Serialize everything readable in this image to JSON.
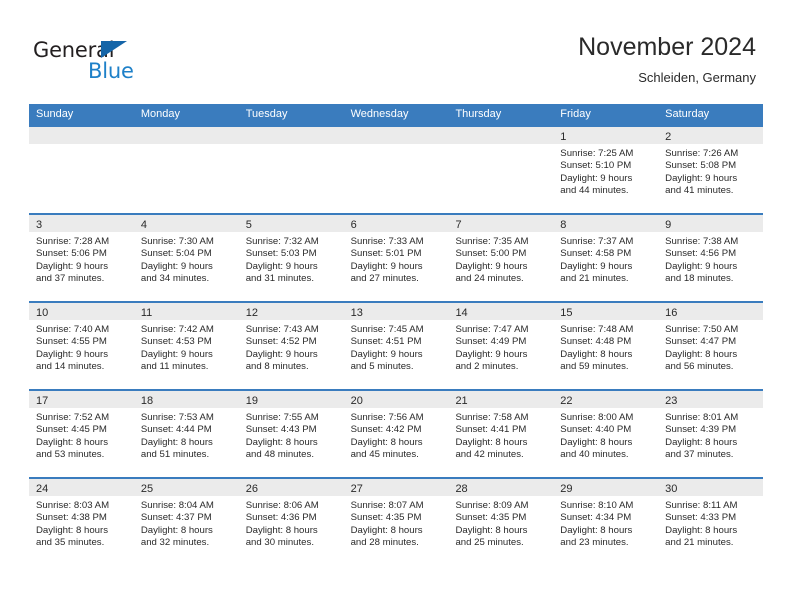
{
  "brand": {
    "name_part1": "General",
    "name_part2": "Blue",
    "triangle_icon": "triangle-icon",
    "accent_color": "#1e80c8",
    "dark_color": "#231f20"
  },
  "header": {
    "title": "November 2024",
    "subtitle": "Schleiden, Germany"
  },
  "theme": {
    "header_blue": "#3a7cbe",
    "daynum_band": "#ebebeb"
  },
  "weekdays": [
    "Sunday",
    "Monday",
    "Tuesday",
    "Wednesday",
    "Thursday",
    "Friday",
    "Saturday"
  ],
  "weeks": [
    [
      {
        "day": "",
        "sunrise": "",
        "sunset": "",
        "daylight_line1": "",
        "daylight_line2": "",
        "empty": true
      },
      {
        "day": "",
        "sunrise": "",
        "sunset": "",
        "daylight_line1": "",
        "daylight_line2": "",
        "empty": true
      },
      {
        "day": "",
        "sunrise": "",
        "sunset": "",
        "daylight_line1": "",
        "daylight_line2": "",
        "empty": true
      },
      {
        "day": "",
        "sunrise": "",
        "sunset": "",
        "daylight_line1": "",
        "daylight_line2": "",
        "empty": true
      },
      {
        "day": "",
        "sunrise": "",
        "sunset": "",
        "daylight_line1": "",
        "daylight_line2": "",
        "empty": true
      },
      {
        "day": "1",
        "sunrise": "Sunrise: 7:25 AM",
        "sunset": "Sunset: 5:10 PM",
        "daylight_line1": "Daylight: 9 hours",
        "daylight_line2": "and 44 minutes.",
        "empty": false
      },
      {
        "day": "2",
        "sunrise": "Sunrise: 7:26 AM",
        "sunset": "Sunset: 5:08 PM",
        "daylight_line1": "Daylight: 9 hours",
        "daylight_line2": "and 41 minutes.",
        "empty": false
      }
    ],
    [
      {
        "day": "3",
        "sunrise": "Sunrise: 7:28 AM",
        "sunset": "Sunset: 5:06 PM",
        "daylight_line1": "Daylight: 9 hours",
        "daylight_line2": "and 37 minutes.",
        "empty": false
      },
      {
        "day": "4",
        "sunrise": "Sunrise: 7:30 AM",
        "sunset": "Sunset: 5:04 PM",
        "daylight_line1": "Daylight: 9 hours",
        "daylight_line2": "and 34 minutes.",
        "empty": false
      },
      {
        "day": "5",
        "sunrise": "Sunrise: 7:32 AM",
        "sunset": "Sunset: 5:03 PM",
        "daylight_line1": "Daylight: 9 hours",
        "daylight_line2": "and 31 minutes.",
        "empty": false
      },
      {
        "day": "6",
        "sunrise": "Sunrise: 7:33 AM",
        "sunset": "Sunset: 5:01 PM",
        "daylight_line1": "Daylight: 9 hours",
        "daylight_line2": "and 27 minutes.",
        "empty": false
      },
      {
        "day": "7",
        "sunrise": "Sunrise: 7:35 AM",
        "sunset": "Sunset: 5:00 PM",
        "daylight_line1": "Daylight: 9 hours",
        "daylight_line2": "and 24 minutes.",
        "empty": false
      },
      {
        "day": "8",
        "sunrise": "Sunrise: 7:37 AM",
        "sunset": "Sunset: 4:58 PM",
        "daylight_line1": "Daylight: 9 hours",
        "daylight_line2": "and 21 minutes.",
        "empty": false
      },
      {
        "day": "9",
        "sunrise": "Sunrise: 7:38 AM",
        "sunset": "Sunset: 4:56 PM",
        "daylight_line1": "Daylight: 9 hours",
        "daylight_line2": "and 18 minutes.",
        "empty": false
      }
    ],
    [
      {
        "day": "10",
        "sunrise": "Sunrise: 7:40 AM",
        "sunset": "Sunset: 4:55 PM",
        "daylight_line1": "Daylight: 9 hours",
        "daylight_line2": "and 14 minutes.",
        "empty": false
      },
      {
        "day": "11",
        "sunrise": "Sunrise: 7:42 AM",
        "sunset": "Sunset: 4:53 PM",
        "daylight_line1": "Daylight: 9 hours",
        "daylight_line2": "and 11 minutes.",
        "empty": false
      },
      {
        "day": "12",
        "sunrise": "Sunrise: 7:43 AM",
        "sunset": "Sunset: 4:52 PM",
        "daylight_line1": "Daylight: 9 hours",
        "daylight_line2": "and 8 minutes.",
        "empty": false
      },
      {
        "day": "13",
        "sunrise": "Sunrise: 7:45 AM",
        "sunset": "Sunset: 4:51 PM",
        "daylight_line1": "Daylight: 9 hours",
        "daylight_line2": "and 5 minutes.",
        "empty": false
      },
      {
        "day": "14",
        "sunrise": "Sunrise: 7:47 AM",
        "sunset": "Sunset: 4:49 PM",
        "daylight_line1": "Daylight: 9 hours",
        "daylight_line2": "and 2 minutes.",
        "empty": false
      },
      {
        "day": "15",
        "sunrise": "Sunrise: 7:48 AM",
        "sunset": "Sunset: 4:48 PM",
        "daylight_line1": "Daylight: 8 hours",
        "daylight_line2": "and 59 minutes.",
        "empty": false
      },
      {
        "day": "16",
        "sunrise": "Sunrise: 7:50 AM",
        "sunset": "Sunset: 4:47 PM",
        "daylight_line1": "Daylight: 8 hours",
        "daylight_line2": "and 56 minutes.",
        "empty": false
      }
    ],
    [
      {
        "day": "17",
        "sunrise": "Sunrise: 7:52 AM",
        "sunset": "Sunset: 4:45 PM",
        "daylight_line1": "Daylight: 8 hours",
        "daylight_line2": "and 53 minutes.",
        "empty": false
      },
      {
        "day": "18",
        "sunrise": "Sunrise: 7:53 AM",
        "sunset": "Sunset: 4:44 PM",
        "daylight_line1": "Daylight: 8 hours",
        "daylight_line2": "and 51 minutes.",
        "empty": false
      },
      {
        "day": "19",
        "sunrise": "Sunrise: 7:55 AM",
        "sunset": "Sunset: 4:43 PM",
        "daylight_line1": "Daylight: 8 hours",
        "daylight_line2": "and 48 minutes.",
        "empty": false
      },
      {
        "day": "20",
        "sunrise": "Sunrise: 7:56 AM",
        "sunset": "Sunset: 4:42 PM",
        "daylight_line1": "Daylight: 8 hours",
        "daylight_line2": "and 45 minutes.",
        "empty": false
      },
      {
        "day": "21",
        "sunrise": "Sunrise: 7:58 AM",
        "sunset": "Sunset: 4:41 PM",
        "daylight_line1": "Daylight: 8 hours",
        "daylight_line2": "and 42 minutes.",
        "empty": false
      },
      {
        "day": "22",
        "sunrise": "Sunrise: 8:00 AM",
        "sunset": "Sunset: 4:40 PM",
        "daylight_line1": "Daylight: 8 hours",
        "daylight_line2": "and 40 minutes.",
        "empty": false
      },
      {
        "day": "23",
        "sunrise": "Sunrise: 8:01 AM",
        "sunset": "Sunset: 4:39 PM",
        "daylight_line1": "Daylight: 8 hours",
        "daylight_line2": "and 37 minutes.",
        "empty": false
      }
    ],
    [
      {
        "day": "24",
        "sunrise": "Sunrise: 8:03 AM",
        "sunset": "Sunset: 4:38 PM",
        "daylight_line1": "Daylight: 8 hours",
        "daylight_line2": "and 35 minutes.",
        "empty": false
      },
      {
        "day": "25",
        "sunrise": "Sunrise: 8:04 AM",
        "sunset": "Sunset: 4:37 PM",
        "daylight_line1": "Daylight: 8 hours",
        "daylight_line2": "and 32 minutes.",
        "empty": false
      },
      {
        "day": "26",
        "sunrise": "Sunrise: 8:06 AM",
        "sunset": "Sunset: 4:36 PM",
        "daylight_line1": "Daylight: 8 hours",
        "daylight_line2": "and 30 minutes.",
        "empty": false
      },
      {
        "day": "27",
        "sunrise": "Sunrise: 8:07 AM",
        "sunset": "Sunset: 4:35 PM",
        "daylight_line1": "Daylight: 8 hours",
        "daylight_line2": "and 28 minutes.",
        "empty": false
      },
      {
        "day": "28",
        "sunrise": "Sunrise: 8:09 AM",
        "sunset": "Sunset: 4:35 PM",
        "daylight_line1": "Daylight: 8 hours",
        "daylight_line2": "and 25 minutes.",
        "empty": false
      },
      {
        "day": "29",
        "sunrise": "Sunrise: 8:10 AM",
        "sunset": "Sunset: 4:34 PM",
        "daylight_line1": "Daylight: 8 hours",
        "daylight_line2": "and 23 minutes.",
        "empty": false
      },
      {
        "day": "30",
        "sunrise": "Sunrise: 8:11 AM",
        "sunset": "Sunset: 4:33 PM",
        "daylight_line1": "Daylight: 8 hours",
        "daylight_line2": "and 21 minutes.",
        "empty": false
      }
    ]
  ]
}
